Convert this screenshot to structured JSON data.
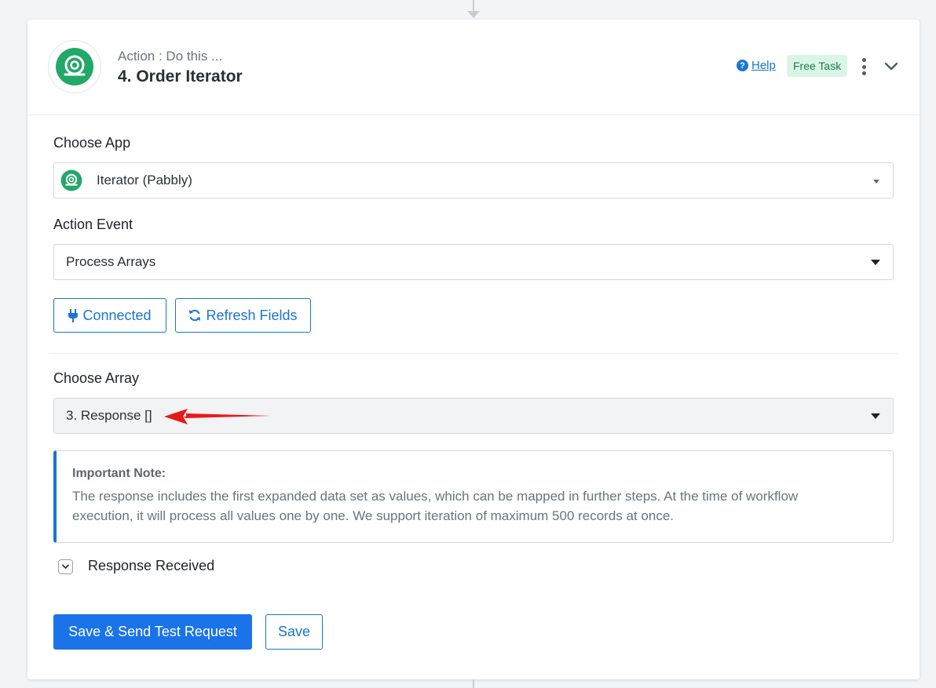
{
  "header": {
    "subtitle": "Action : Do this ...",
    "title": "4. Order Iterator",
    "help_label": "Help",
    "badge": "Free Task",
    "logo_icon": "iterator-logo-icon"
  },
  "choose_app": {
    "label": "Choose App",
    "value": "Iterator (Pabbly)"
  },
  "action_event": {
    "label": "Action Event",
    "value": "Process Arrays"
  },
  "buttons": {
    "connected": "Connected",
    "refresh": "Refresh Fields",
    "save_send": "Save & Send Test Request",
    "save": "Save"
  },
  "choose_array": {
    "label": "Choose Array",
    "value": "3. Response []"
  },
  "note": {
    "title": "Important Note:",
    "body": "The response includes the first expanded data set as values, which can be mapped in further steps. At the time of workflow execution, it will process all values one by one. We support iteration of maximum 500 records at once."
  },
  "response": {
    "label": "Response Received"
  },
  "colors": {
    "accent": "#1976d2",
    "brand_green": "#22a867",
    "badge_bg": "#d9f5e6",
    "arrow_red": "#e8191a"
  }
}
